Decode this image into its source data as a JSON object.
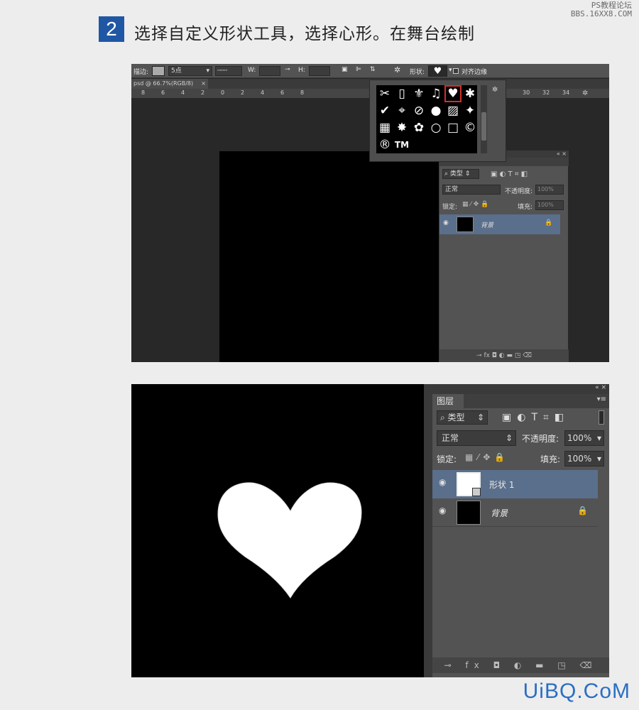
{
  "header": {
    "step": "2",
    "title": "选择自定义形状工具，选择心形。在舞台绘制"
  },
  "watermarks": {
    "top": [
      "PS教程论坛",
      "BBS.16XX8.COM"
    ],
    "bottom": "UiBQ.CoM"
  },
  "shot1": {
    "options": {
      "stroke_label": "描边:",
      "stroke_size": "5点",
      "w_label": "W:",
      "h_label": "H:",
      "shape_label": "形状:",
      "align_label": "对齐边缘"
    },
    "tab": "psd @ 66.7%(RGB/8)",
    "tab_close": "×",
    "ruler_ticks": [
      "8",
      "6",
      "4",
      "2",
      "0",
      "2",
      "4",
      "6",
      "8",
      "30",
      "32",
      "34"
    ],
    "layers": {
      "kind": "类型",
      "blend": "正常",
      "opacity_label": "不透明度:",
      "opacity": "100%",
      "lock_label": "锁定:",
      "fill_label": "填充:",
      "fill": "100%",
      "bg_layer": "背景"
    }
  },
  "shot2": {
    "layers": {
      "tab": "图层",
      "kind": "类型",
      "blend": "正常",
      "opacity_label": "不透明度:",
      "opacity": "100%",
      "lock_label": "锁定:",
      "fill_label": "填充:",
      "fill": "100%",
      "shape_layer": "形状 1",
      "bg_layer": "背景"
    }
  },
  "shape_grid": [
    "✂",
    "▯",
    "⚜",
    "♫",
    "♥",
    "✱",
    "✔",
    "⌖",
    "⊘",
    "●",
    "▨",
    "✦",
    "▦",
    "✸",
    "✿",
    "○",
    "□",
    "©",
    "®",
    "TM"
  ],
  "colors": {
    "accent": "#1f57a5",
    "panel": "#535353",
    "selected_layer": "#5a6f8c",
    "highlight": "#d0302c"
  }
}
